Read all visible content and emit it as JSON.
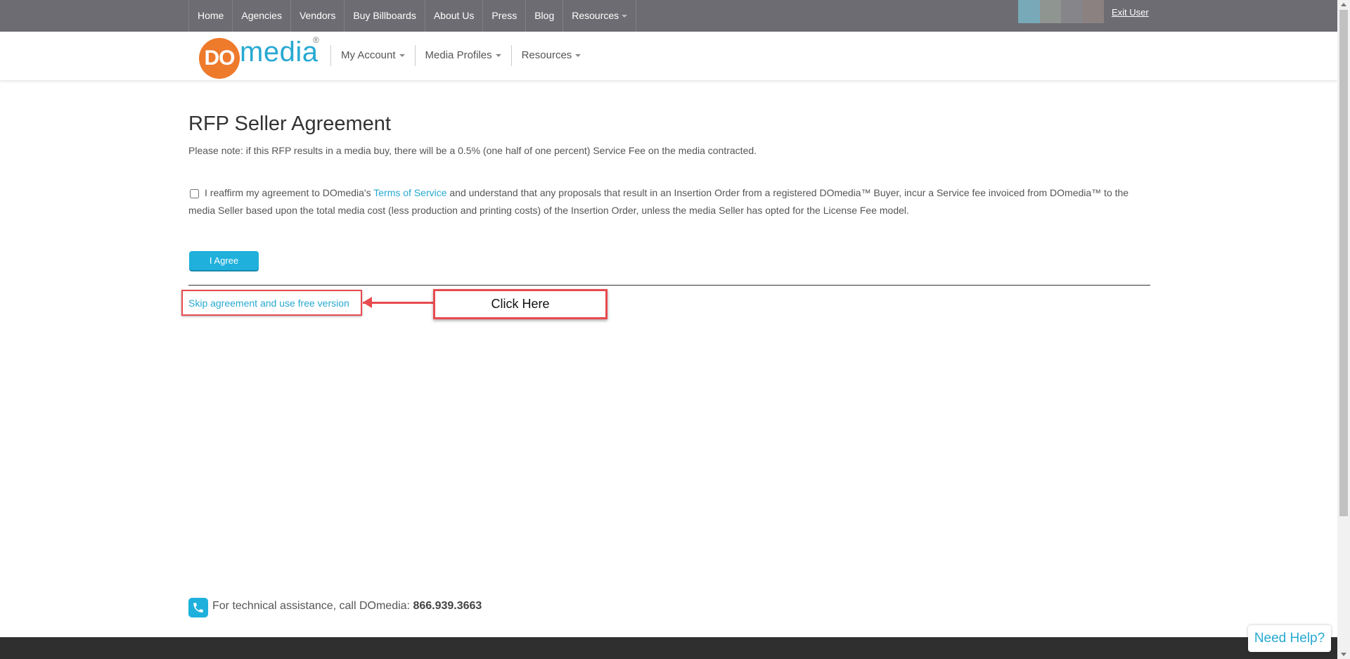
{
  "topnav": {
    "items": [
      "Home",
      "Agencies",
      "Vendors",
      "Buy Billboards",
      "About Us",
      "Press",
      "Blog",
      "Resources"
    ],
    "exit_user": "Exit User",
    "avatar_colors": [
      "#78a9b8",
      "#8f9590",
      "#86868a",
      "#8b8181"
    ]
  },
  "header": {
    "logo_do": "DO",
    "logo_media": "media",
    "logo_reg": "®",
    "nav": [
      "My Account",
      "Media Profiles",
      "Resources"
    ]
  },
  "page": {
    "title": "RFP Seller Agreement",
    "note": "Please note: if this RFP results in a media buy, there will be a 0.5% (one half of one percent) Service Fee on the media contracted.",
    "agreement_pre": "I reaffirm my agreement to DOmedia's ",
    "agreement_link": "Terms of Service",
    "agreement_post": " and understand that any proposals that result in an Insertion Order from a registered DOmedia™ Buyer, incur a Service fee invoiced from DOmedia™ to the media Seller based upon the total media cost (less production and printing costs) of the Insertion Order, unless the media Seller has opted for the License Fee model.",
    "agree_button": "I Agree",
    "skip_link": "Skip agreement and use free version",
    "callout": "Click Here"
  },
  "footer": {
    "tech_text": "For technical assistance, call DOmedia: ",
    "tech_phone": "866.939.3663",
    "need_help": "Need Help?"
  },
  "colors": {
    "topbar": "#6d6c72",
    "accent": "#27a9d1",
    "logo_orange": "#ee7a2c",
    "annotation_red": "#e84b50",
    "footer": "#2f2f2f"
  }
}
